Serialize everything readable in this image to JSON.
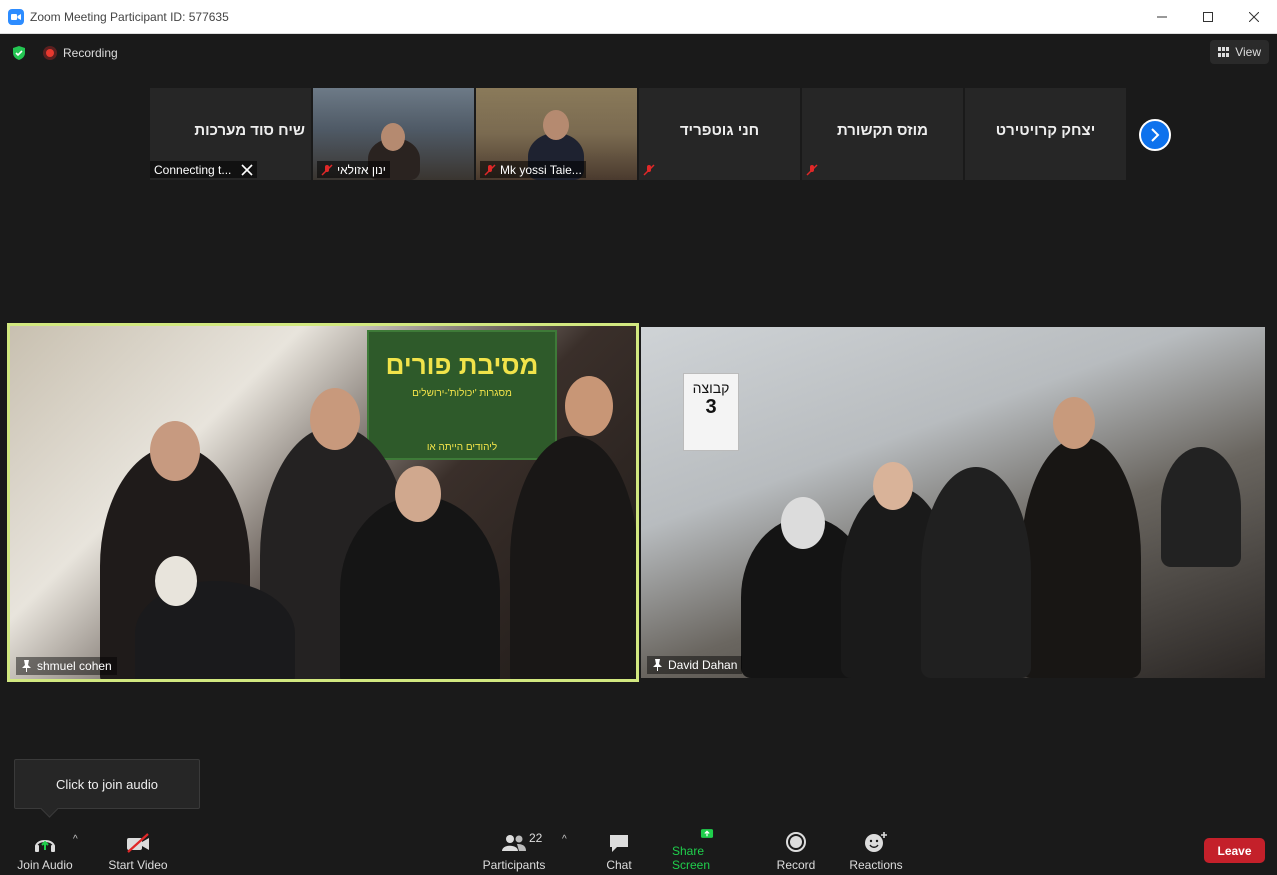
{
  "window": {
    "title": "Zoom Meeting Participant ID: 577635"
  },
  "topbar": {
    "recording_label": "Recording",
    "view_label": "View"
  },
  "strip": {
    "thumbs": [
      {
        "name": "שיח סוד מערכות",
        "label": "Connecting t..."
      },
      {
        "name": "",
        "label": "ינון אזולאי"
      },
      {
        "name": "",
        "label": "Mk yossi Taie..."
      },
      {
        "name": "חני גוטפריד",
        "label": ""
      },
      {
        "name": "מוזס תקשורת",
        "label": ""
      },
      {
        "name": "יצחק קרויטירט",
        "label": ""
      }
    ]
  },
  "tiles": {
    "left_name": "shmuel cohen",
    "right_name": "David Dahan",
    "banner_title": "מסיבת פורים",
    "banner_sub": "מסגרות 'יכולות'-ירושלים",
    "banner_foot": "ליהודים הייתה או",
    "sign_line1": "קבוצה",
    "sign_line2": "3"
  },
  "tooltip": {
    "text": "Click to join audio"
  },
  "toolbar": {
    "join_audio": "Join Audio",
    "start_video": "Start Video",
    "participants": "Participants",
    "participants_count": "22",
    "chat": "Chat",
    "share_screen": "Share Screen",
    "record": "Record",
    "reactions": "Reactions",
    "leave": "Leave"
  },
  "colors": {
    "accent_blue": "#0e72ed",
    "active_speaker_border": "#d2e880",
    "share_green": "#1fcf4c",
    "leave_red": "#c4202a"
  }
}
